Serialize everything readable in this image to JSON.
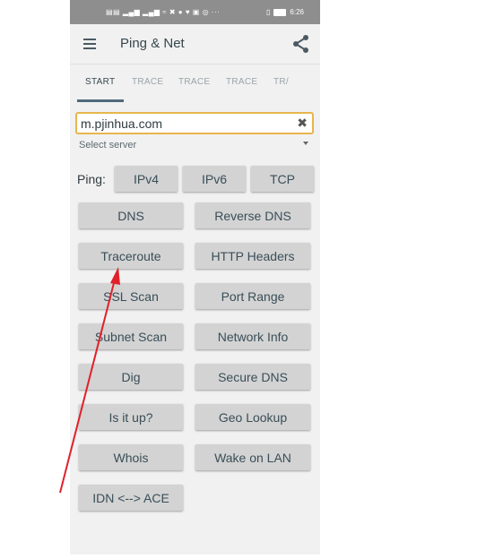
{
  "status_bar": {
    "left_icons": "▤▤ ▂▄▆ ▂▄▆ ≈ ✖ ● ♥ ▣ ◎ ···",
    "vibrate": "▯",
    "time": "6:26"
  },
  "app_bar": {
    "title": "Ping & Net"
  },
  "tabs": [
    "START",
    "TRACE",
    "TRACE",
    "TRACE",
    "TR/"
  ],
  "host_input": {
    "value": "m.pjinhua.com"
  },
  "server_select": {
    "label": "Select server"
  },
  "ping": {
    "label": "Ping:",
    "buttons": [
      "IPv4",
      "IPv6",
      "TCP"
    ]
  },
  "tools": [
    "DNS",
    "Reverse DNS",
    "Traceroute",
    "HTTP Headers",
    "SSL Scan",
    "Port Range",
    "Subnet Scan",
    "Network Info",
    "Dig",
    "Secure DNS",
    "Is it up?",
    "Geo Lookup",
    "Whois",
    "Wake on LAN",
    "IDN <--> ACE"
  ],
  "colors": {
    "accent_input_border": "#e8b54d",
    "button_bg": "#d3d3d3",
    "button_text": "#3a4e58",
    "annotation_arrow": "#e0202a"
  }
}
